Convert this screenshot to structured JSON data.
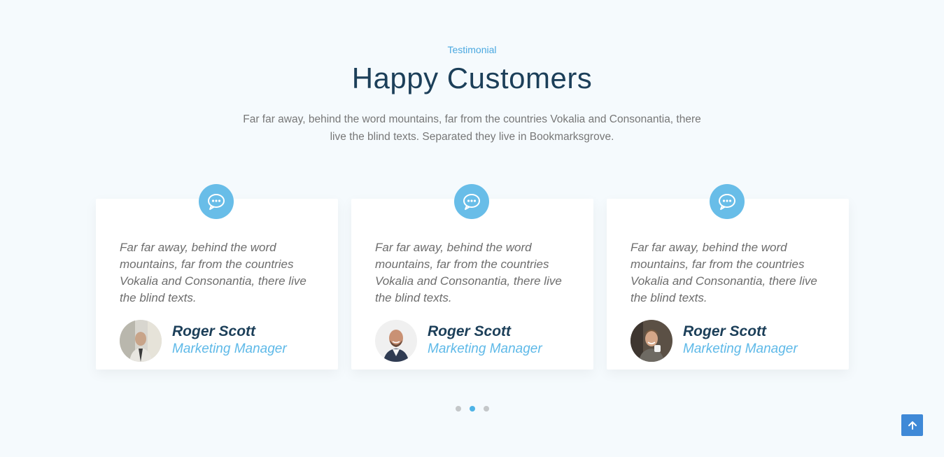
{
  "section": {
    "kicker": "Testimonial",
    "title": "Happy Customers",
    "intro": "Far far away, behind the word mountains, far from the countries Vokalia and Consonantia, there live the blind texts. Separated they live in Bookmarksgrove."
  },
  "testimonials": [
    {
      "text": "Far far away, behind the word mountains, far from the countries Vokalia and Consonantia, there live the blind texts.",
      "name": "Roger Scott",
      "role": "Marketing Manager"
    },
    {
      "text": "Far far away, behind the word mountains, far from the countries Vokalia and Consonantia, there live the blind texts.",
      "name": "Roger Scott",
      "role": "Marketing Manager"
    },
    {
      "text": "Far far away, behind the word mountains, far from the countries Vokalia and Consonantia, there live the blind texts.",
      "name": "Roger Scott",
      "role": "Marketing Manager"
    }
  ],
  "carousel": {
    "page_count": 3,
    "active_index": 1
  },
  "colors": {
    "accent": "#68bde8",
    "title": "#1c3f59",
    "scroll_top": "#3f89d7"
  },
  "icons": {
    "quote_badge": "chat-bubble-icon",
    "scroll_top": "arrow-up-icon"
  }
}
